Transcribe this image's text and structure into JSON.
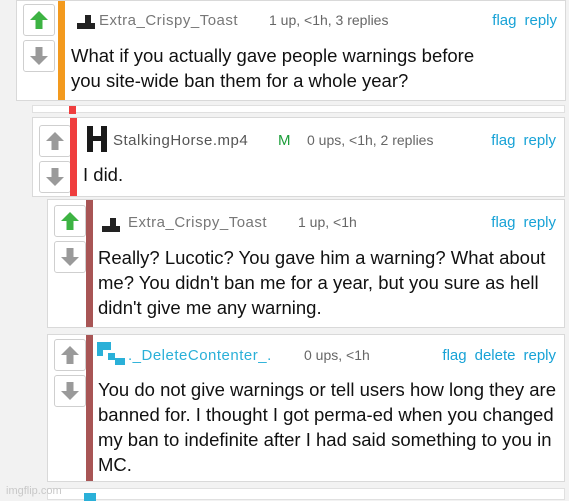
{
  "comments": [
    {
      "username": "Extra_Crispy_Toast",
      "meta": "1 up, <1h, 3 replies",
      "actions": [
        "flag",
        "reply"
      ],
      "body": "What if you actually gave people warnings before you site-wide ban them for a whole year?",
      "upvoted": true,
      "bar_color": "#f39a1e"
    },
    {
      "username": "StalkingHorse.mp4",
      "mod_badge": "M",
      "meta": "0 ups, <1h, 2 replies",
      "actions": [
        "flag",
        "reply"
      ],
      "body": "I did.",
      "upvoted": false,
      "bar_color": "#ef3e3e"
    },
    {
      "username": "Extra_Crispy_Toast",
      "meta": "1 up, <1h",
      "actions": [
        "flag",
        "reply"
      ],
      "body": "Really? Lucotic? You gave him a warning? What about me? You didn't ban me for a year, but you sure as hell didn't give me any warning.",
      "upvoted": true,
      "bar_color": "#a85555"
    },
    {
      "username": "._DeleteContenter_.",
      "meta": "0 ups, <1h",
      "actions": [
        "flag",
        "delete",
        "reply"
      ],
      "body": "You do not give warnings or tell users how long they are banned for. I thought I got perma-ed when you changed my ban to indefinite after I had said something to you in MC.",
      "upvoted": false,
      "bar_color": "#a85555"
    }
  ],
  "watermark": "imgflip.com",
  "colors": {
    "upvote_active": "#3db343",
    "vote_inactive": "#9a9a9a",
    "link": "#17a2d6",
    "mod": "#1c9e3a",
    "delete_user": "#2ab0d8"
  }
}
